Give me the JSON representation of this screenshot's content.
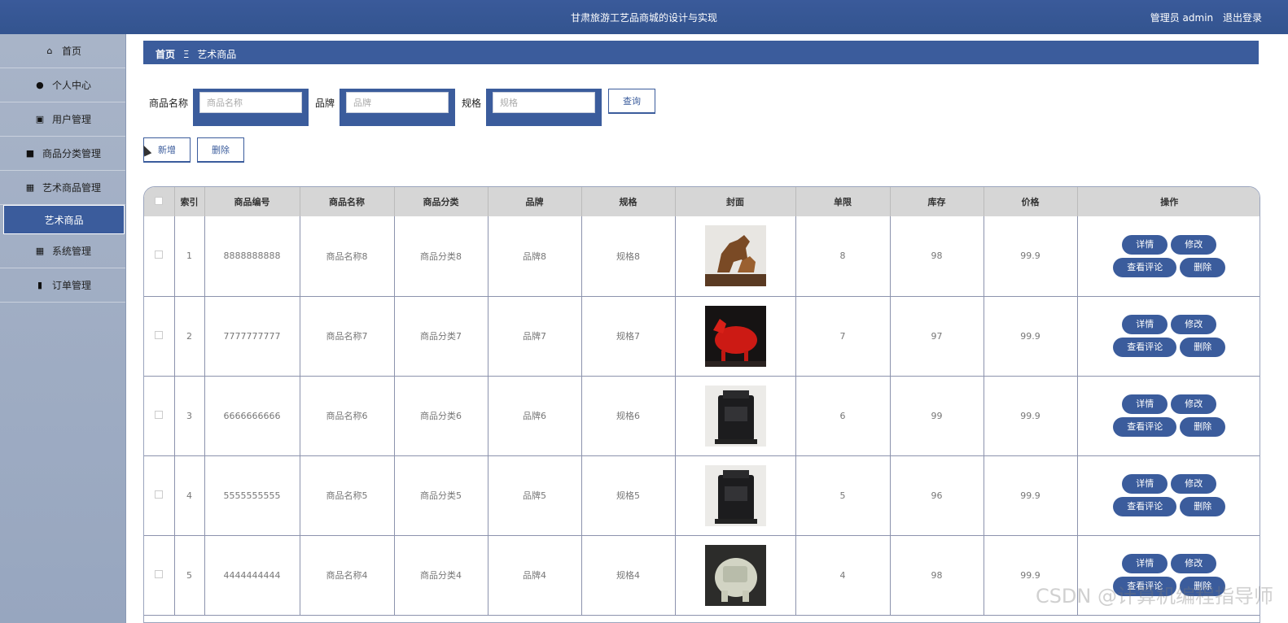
{
  "header": {
    "title": "甘肃旅游工艺品商城的设计与实现",
    "user_label": "管理员 admin",
    "logout": "退出登录"
  },
  "sidebar": {
    "items": [
      {
        "label": "首页",
        "icon": "home-icon"
      },
      {
        "label": "个人中心",
        "icon": "user-icon"
      },
      {
        "label": "用户管理",
        "icon": "clipboard-icon"
      },
      {
        "label": "商品分类管理",
        "icon": "briefcase-icon"
      },
      {
        "label": "艺术商品管理",
        "icon": "grid-icon"
      },
      {
        "label": "艺术商品",
        "icon": ""
      },
      {
        "label": "系统管理",
        "icon": "grid-icon"
      },
      {
        "label": "订单管理",
        "icon": "book-icon"
      }
    ]
  },
  "breadcrumb": {
    "home": "首页",
    "sep": "Ξ",
    "current": "艺术商品"
  },
  "search": {
    "name_label": "商品名称",
    "name_placeholder": "商品名称",
    "brand_label": "品牌",
    "brand_placeholder": "品牌",
    "spec_label": "规格",
    "spec_placeholder": "规格",
    "query": "查询"
  },
  "actions": {
    "add": "新增",
    "delete": "删除"
  },
  "table": {
    "headers": [
      "索引",
      "商品编号",
      "商品名称",
      "商品分类",
      "品牌",
      "规格",
      "封面",
      "单限",
      "库存",
      "价格",
      "操作"
    ],
    "rows": [
      {
        "index": "1",
        "code": "8888888888",
        "name": "商品名称8",
        "category": "商品分类8",
        "brand": "品牌8",
        "spec": "规格8",
        "limit": "8",
        "stock": "98",
        "price": "99.9",
        "cover": "horse-statue"
      },
      {
        "index": "2",
        "code": "7777777777",
        "name": "商品名称7",
        "category": "商品分类7",
        "brand": "品牌7",
        "spec": "规格7",
        "limit": "7",
        "stock": "97",
        "price": "99.9",
        "cover": "red-horse"
      },
      {
        "index": "3",
        "code": "6666666666",
        "name": "商品名称6",
        "category": "商品分类6",
        "brand": "品牌6",
        "spec": "规格6",
        "limit": "6",
        "stock": "99",
        "price": "99.9",
        "cover": "black-box"
      },
      {
        "index": "4",
        "code": "5555555555",
        "name": "商品名称5",
        "category": "商品分类5",
        "brand": "品牌5",
        "spec": "规格5",
        "limit": "5",
        "stock": "96",
        "price": "99.9",
        "cover": "black-box"
      },
      {
        "index": "5",
        "code": "4444444444",
        "name": "商品名称4",
        "category": "商品分类4",
        "brand": "品牌4",
        "spec": "规格4",
        "limit": "4",
        "stock": "98",
        "price": "99.9",
        "cover": "jade-elephant"
      }
    ],
    "ops": {
      "detail": "详情",
      "edit": "修改",
      "comments": "查看评论",
      "delete": "删除"
    }
  },
  "watermark": "CSDN @计算机编程指导师",
  "colors": {
    "primary": "#3b5c9c",
    "sidebar": "#a8b4c8",
    "active": "#1a6fe8"
  }
}
